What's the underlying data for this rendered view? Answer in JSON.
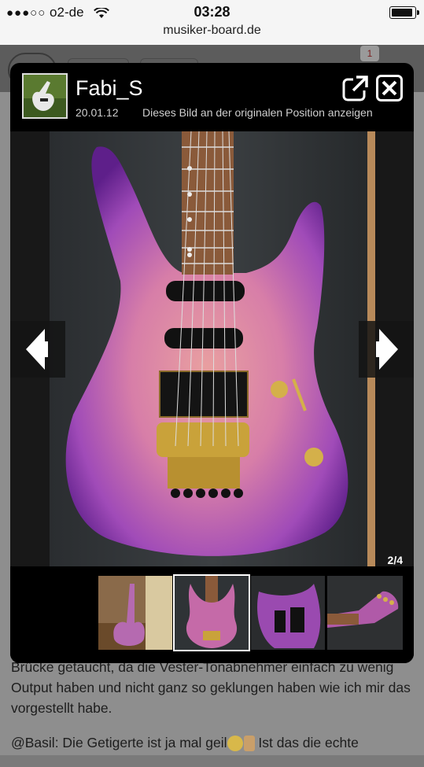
{
  "status_bar": {
    "carrier": "o2-de",
    "signal_dots": "●●●○○",
    "time": "03:28",
    "url": "musiker-board.de"
  },
  "background_page": {
    "badge_count": "1",
    "paragraph_1": "Brücke getaucht, da die Vester-Tonabnehmer einfach zu wenig Output haben und nicht ganz so geklungen haben wie ich mir das vorgestellt habe.",
    "paragraph_2_before": "@Basil: Die Getigerte ist ja mal geil",
    "paragraph_2_after": " Ist das die echte"
  },
  "lightbox": {
    "author": "Fabi_S",
    "date": "20.01.12",
    "original_position_link": "Dieses Bild an der originalen Position anzeigen",
    "counter": "2/4",
    "icons": {
      "open": "external-link-icon",
      "close": "close-icon",
      "prev": "arrow-left-icon",
      "next": "arrow-right-icon"
    },
    "thumbnails": [
      {
        "name": "thumbnail-1",
        "active": false
      },
      {
        "name": "thumbnail-2",
        "active": true
      },
      {
        "name": "thumbnail-3",
        "active": false
      },
      {
        "name": "thumbnail-4",
        "active": false
      }
    ]
  },
  "colors": {
    "lightbox_bg": "#000000",
    "overlay_page": "#8e8e8e",
    "guitar_purple": "#8e3fb0",
    "guitar_pink": "#d889a8"
  }
}
